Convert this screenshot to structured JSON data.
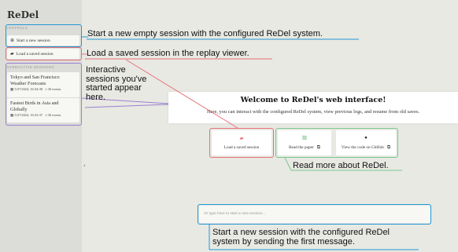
{
  "app": {
    "title": "ReDel"
  },
  "sidebar": {
    "controls_label": "CONTROLS",
    "start_button": "Start a new session",
    "load_button": "Load a saved session",
    "interactive_label": "INTERACTIVE SESSIONS",
    "sessions": [
      {
        "title": "Tokyo and San Francisco Weather Forecasts",
        "date": "5/27/2024, 16:34:38",
        "events": "30 events"
      },
      {
        "title": "Fastest Birds in Asia and Globally",
        "date": "5/27/2024, 16:33:37",
        "events": "30 events"
      }
    ]
  },
  "welcome": {
    "title": "Welcome to ReDel's web interface!",
    "subtitle": "Here, you can interact with the configured ReDel system, view previous logs, and resume from old saves."
  },
  "actions": {
    "load": "Load a saved session",
    "paper": "Read the paper",
    "github": "View the code on GitHub"
  },
  "chat": {
    "placeholder": "Or type here to start a new session..."
  },
  "annotations": {
    "start": "Start a new empty session with the configured ReDel system.",
    "load": "Load a saved session in the replay viewer.",
    "interactive": [
      "Interactive",
      "sessions you've",
      "started appear",
      "here."
    ],
    "read_more": "Read more about ReDel.",
    "new_session": [
      "Start a new session with the configured ReDel",
      "system by sending the first message."
    ]
  },
  "colors": {
    "blue": "#1f97d4",
    "red": "#e8707a",
    "purple": "#9b7fd0",
    "green": "#7cc691"
  },
  "icons": {
    "start": "plus-circle-icon",
    "load": "folder-icon",
    "calendar": "calendar-icon",
    "events": "list-icon",
    "paper": "book-icon",
    "github": "github-icon",
    "external": "external-link-icon",
    "collapse": "chevron-left-icon"
  }
}
